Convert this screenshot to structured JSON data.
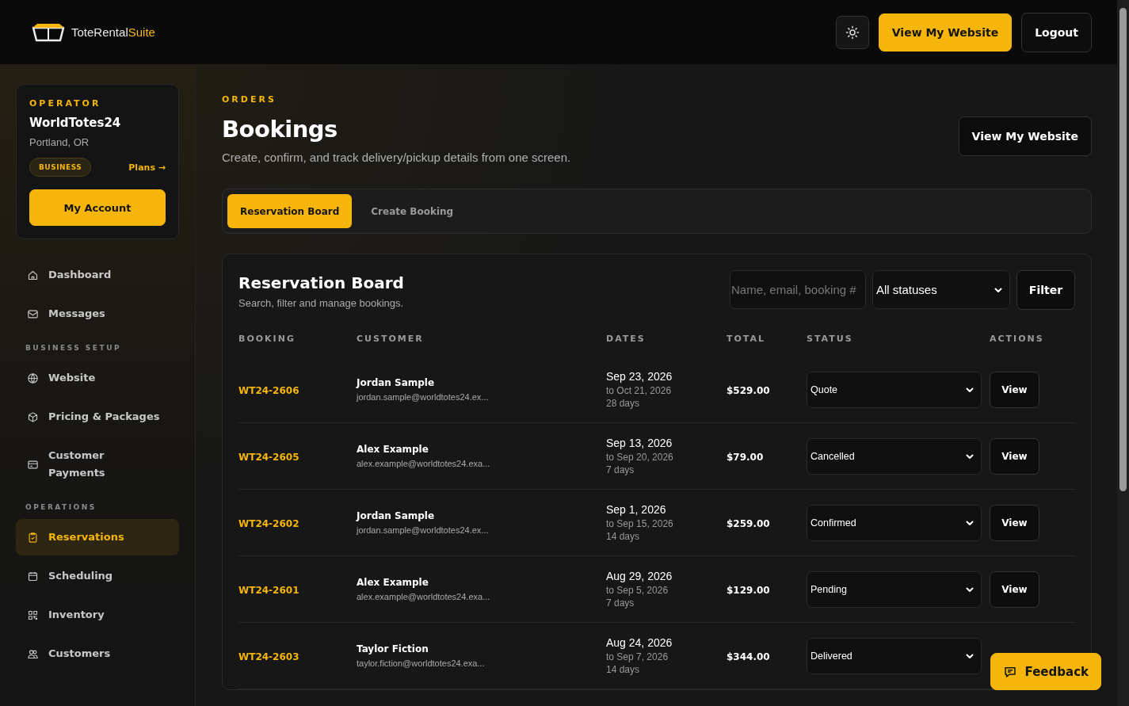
{
  "brand": {
    "name": "ToteRental",
    "suffix": "Suite"
  },
  "header_buttons": {
    "website": "View My Website",
    "logout": "Logout"
  },
  "operator": {
    "label": "OPERATOR",
    "name": "WorldTotes24",
    "location": "Portland, OR",
    "plan_badge": "BUSINESS",
    "plans_link": "Plans →",
    "account_button": "My Account"
  },
  "sidebar": {
    "sections": [
      {
        "items": [
          {
            "label": "Dashboard",
            "selected": false
          },
          {
            "label": "Messages",
            "selected": false
          }
        ]
      },
      {
        "title": "BUSINESS SETUP",
        "items": [
          {
            "label": "Website",
            "selected": false
          },
          {
            "label": "Pricing & Packages",
            "selected": false
          },
          {
            "label": "Customer Payments",
            "selected": false
          }
        ]
      },
      {
        "title": "OPERATIONS",
        "items": [
          {
            "label": "Reservations",
            "selected": true
          },
          {
            "label": "Scheduling",
            "selected": false
          },
          {
            "label": "Inventory",
            "selected": false
          },
          {
            "label": "Customers",
            "selected": false
          }
        ]
      }
    ]
  },
  "page": {
    "eyebrow": "ORDERS",
    "title": "Bookings",
    "subtitle": "Create, confirm, and track delivery/pickup details from one screen.",
    "website_button": "View My Website"
  },
  "tabs": [
    {
      "label": "Reservation Board",
      "selected": true
    },
    {
      "label": "Create Booking",
      "selected": false
    }
  ],
  "board": {
    "title": "Reservation Board",
    "subtitle": "Search, filter and manage bookings.",
    "search": {
      "placeholder": "Name, email, booking #"
    },
    "status_filter": "All statuses",
    "filter_button": "Filter"
  },
  "table": {
    "columns": [
      "BOOKING",
      "CUSTOMER",
      "DATES",
      "TOTAL",
      "STATUS",
      "ACTIONS"
    ],
    "rows": [
      {
        "booking": "WT24-2606",
        "name": "Jordan Sample",
        "email": "jordan.sample@worldtotes24.ex...",
        "start": "Sep 23, 2026",
        "end": "to Oct 21, 2026",
        "duration": "28 days",
        "total": "$529.00",
        "status": "Quote",
        "action": "View"
      },
      {
        "booking": "WT24-2605",
        "name": "Alex Example",
        "email": "alex.example@worldtotes24.exa...",
        "start": "Sep 13, 2026",
        "end": "to Sep 20, 2026",
        "duration": "7 days",
        "total": "$79.00",
        "status": "Cancelled",
        "action": "View"
      },
      {
        "booking": "WT24-2602",
        "name": "Jordan Sample",
        "email": "jordan.sample@worldtotes24.ex...",
        "start": "Sep 1, 2026",
        "end": "to Sep 15, 2026",
        "duration": "14 days",
        "total": "$259.00",
        "status": "Confirmed",
        "action": "View"
      },
      {
        "booking": "WT24-2601",
        "name": "Alex Example",
        "email": "alex.example@worldtotes24.exa...",
        "start": "Aug 29, 2026",
        "end": "to Sep 5, 2026",
        "duration": "7 days",
        "total": "$129.00",
        "status": "Pending",
        "action": "View"
      },
      {
        "booking": "WT24-2603",
        "name": "Taylor Fiction",
        "email": "taylor.fiction@worldtotes24.exa...",
        "start": "Aug 24, 2026",
        "end": "to Sep 7, 2026",
        "duration": "14 days",
        "total": "$344.00",
        "status": "Delivered"
      }
    ]
  },
  "feedback_button": "Feedback"
}
